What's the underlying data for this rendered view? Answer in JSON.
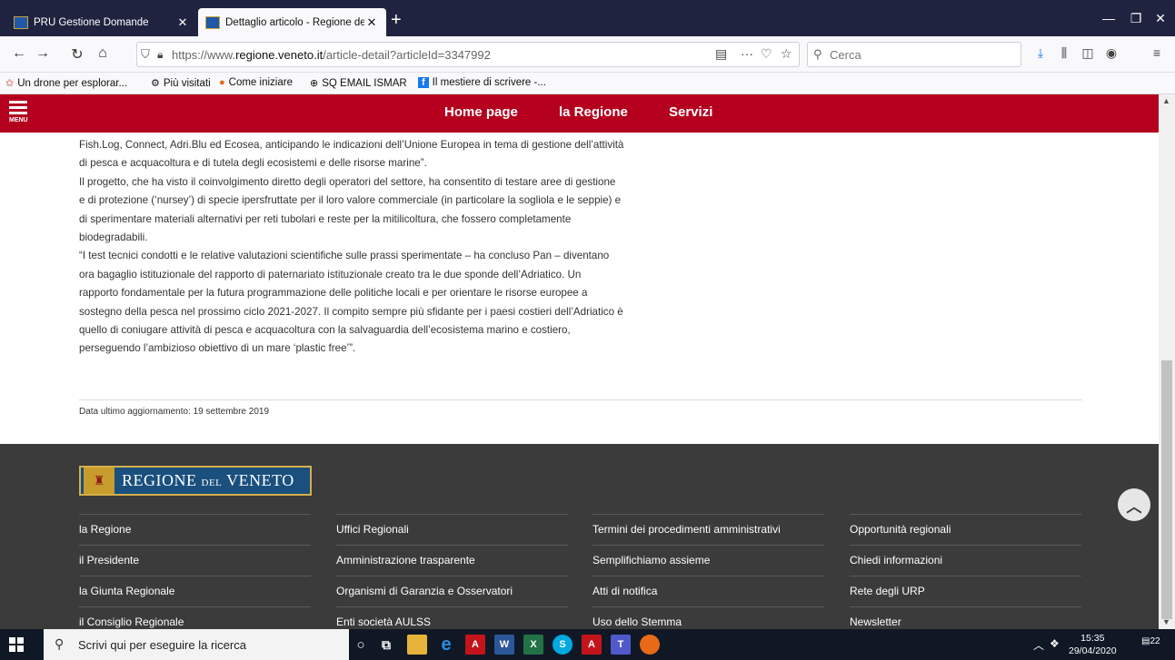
{
  "browser": {
    "tabs": [
      {
        "title": "PRU Gestione Domande",
        "active": false
      },
      {
        "title": "Dettaglio articolo - Regione del",
        "active": true
      }
    ],
    "url_prefix": "https://www.",
    "url_domain": "regione.veneto.it",
    "url_path": "/article-detail?articleId=3347992",
    "search_placeholder": "Cerca",
    "bookmarks": [
      "Un drone per esplorar...",
      "Più visitati",
      "Come iniziare",
      "SQ EMAIL ISMAR",
      "Il mestiere di scrivere -..."
    ]
  },
  "site": {
    "menu_label": "MENU",
    "nav": [
      "Home page",
      "la Regione",
      "Servizi"
    ],
    "brand_color": "#b4001e"
  },
  "article": {
    "lines": [
      "Fish.Log, Connect, Adri.Blu ed Ecosea, anticipando le indicazioni dell’Unione Europea in tema di gestione dell’attività",
      "di pesca e acquacoltura e di tutela degli ecosistemi e delle risorse marine”.",
      "Il progetto, che ha visto il coinvolgimento diretto degli operatori del settore, ha consentito di testare aree di gestione",
      "e di protezione (‘nursey’) di specie ipersfruttate per il loro valore commerciale (in particolare la sogliola e le seppie) e",
      "di sperimentare materiali alternativi per reti tubolari e reste per la mitilicoltura, che fossero completamente",
      "biodegradabili.",
      "“I test tecnici condotti e le relative valutazioni scientifiche sulle prassi sperimentate – ha concluso Pan – diventano",
      "ora bagaglio istituzionale del rapporto di paternariato istituzionale creato tra le due sponde dell’Adriatico. Un",
      "rapporto fondamentale per la futura programmazione delle politiche locali e per orientare le risorse europee a",
      "sostegno della pesca nel prossimo ciclo 2021-2027. Il compito sempre più sfidante per i paesi costieri dell’Adriatico è",
      "quello di coniugare attività di pesca e acquacoltura con la salvaguardia dell’ecosistema marino e costiero,",
      "perseguendo l’ambizioso obiettivo di un mare ‘plastic free’”."
    ],
    "last_update": "Data ultimo aggiornamento: 19 settembre 2019"
  },
  "footer": {
    "logo_text_a": "REGIONE",
    "logo_text_b": "DEL",
    "logo_text_c": "VENETO",
    "col1": [
      "la Regione",
      "il Presidente",
      "la Giunta Regionale",
      "il Consiglio Regionale"
    ],
    "col2": [
      "Uffici Regionali",
      "Amministrazione trasparente",
      "Organismi di Garanzia e Osservatori",
      "Enti società AULSS"
    ],
    "col3": [
      "Termini dei procedimenti amministrativi",
      "Semplifichiamo assieme",
      "Atti di notifica",
      "Uso dello Stemma"
    ],
    "col4": [
      "Opportunità regionali",
      "Chiedi informazioni",
      "Rete degli URP",
      "Newsletter"
    ]
  },
  "taskbar": {
    "search_placeholder": "Scrivi qui per eseguire la ricerca",
    "time": "15:35",
    "date": "29/04/2020",
    "notifications": "22"
  }
}
